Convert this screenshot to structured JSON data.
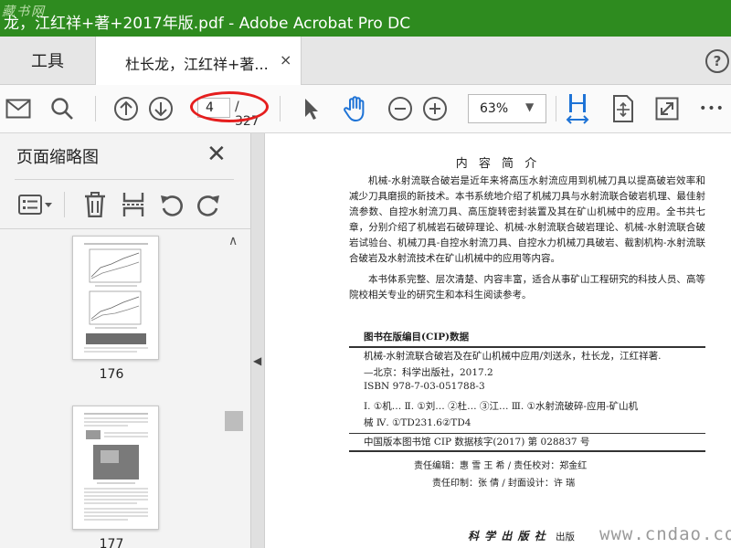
{
  "window": {
    "title": "龙，江红祥+著+2017年版.pdf - Adobe Acrobat Pro DC",
    "watermark": "藏书网"
  },
  "tabs": {
    "tools_label": "工具",
    "doc_label": "杜长龙，江红祥+著...",
    "close_glyph": "×",
    "help_glyph": "?"
  },
  "toolbar": {
    "current_page": "4",
    "total_pages": "/ 327",
    "zoom": "63%",
    "icons": [
      "mail-icon",
      "search-icon",
      "prev-page-icon",
      "next-page-icon",
      "select-arrow-icon",
      "hand-icon",
      "zoom-out-icon",
      "zoom-in-icon",
      "fit-width-icon",
      "fit-page-icon",
      "fullscreen-icon",
      "more-icon"
    ],
    "more_glyph": "•••",
    "accent": "#1e73d6",
    "highlight": "#e51e1e"
  },
  "left_panel": {
    "title": "页面缩略图",
    "close_glyph": "✕",
    "thumbnails": [
      {
        "page": "176"
      },
      {
        "page": "177"
      }
    ]
  },
  "document": {
    "heading": "内 容 简 介",
    "para1": "机械-水射流联合破岩是近年来将高压水射流应用到机械刀具以提高破岩效率和减少刀具磨损的新技术。本书系统地介绍了机械刀具与水射流联合破岩机理、最佳射流参数、自控水射流刀具、高压旋转密封装置及其在矿山机械中的应用。全书共七章，分别介绍了机械岩石破碎理论、机械-水射流联合破岩理论、机械-水射流联合破岩试验台、机械刀具-自控水射流刀具、自控水力机械刀具破岩、截割机构-水射流联合破岩及水射流技术在矿山机械中的应用等内容。",
    "para2": "本书体系完整、层次清楚、内容丰富，适合从事矿山工程研究的科技人员、高等院校相关专业的研究生和本科生阅读参考。",
    "cip_heading": "图书在版编目(CIP)数据",
    "cip_line1": "机械-水射流联合破岩及在矿山机械中应用/刘送永，杜长龙，江红祥著.",
    "cip_line2": "—北京：科学出版社，2017.2",
    "cip_line3": "ISBN 978-7-03-051788-3",
    "cip_line4": "Ⅰ. ①机…  Ⅱ. ①刘…  ②杜…  ③江…    Ⅲ. ①水射流破碎-应用-矿山机",
    "cip_line5": "械   Ⅳ. ①TD231.6②TD4",
    "cip_number": "中国版本图书馆 CIP 数据核字(2017)  第 028837 号",
    "editor_line": "责任编辑：惠  雪  王  希 / 责任校对：郑金红",
    "print_line": "责任印制：张  倩 / 封面设计：许  瑞",
    "publisher": "科 学 出 版 社",
    "publisher_suffix": "出版"
  },
  "site_watermark": "www.cndao.com"
}
